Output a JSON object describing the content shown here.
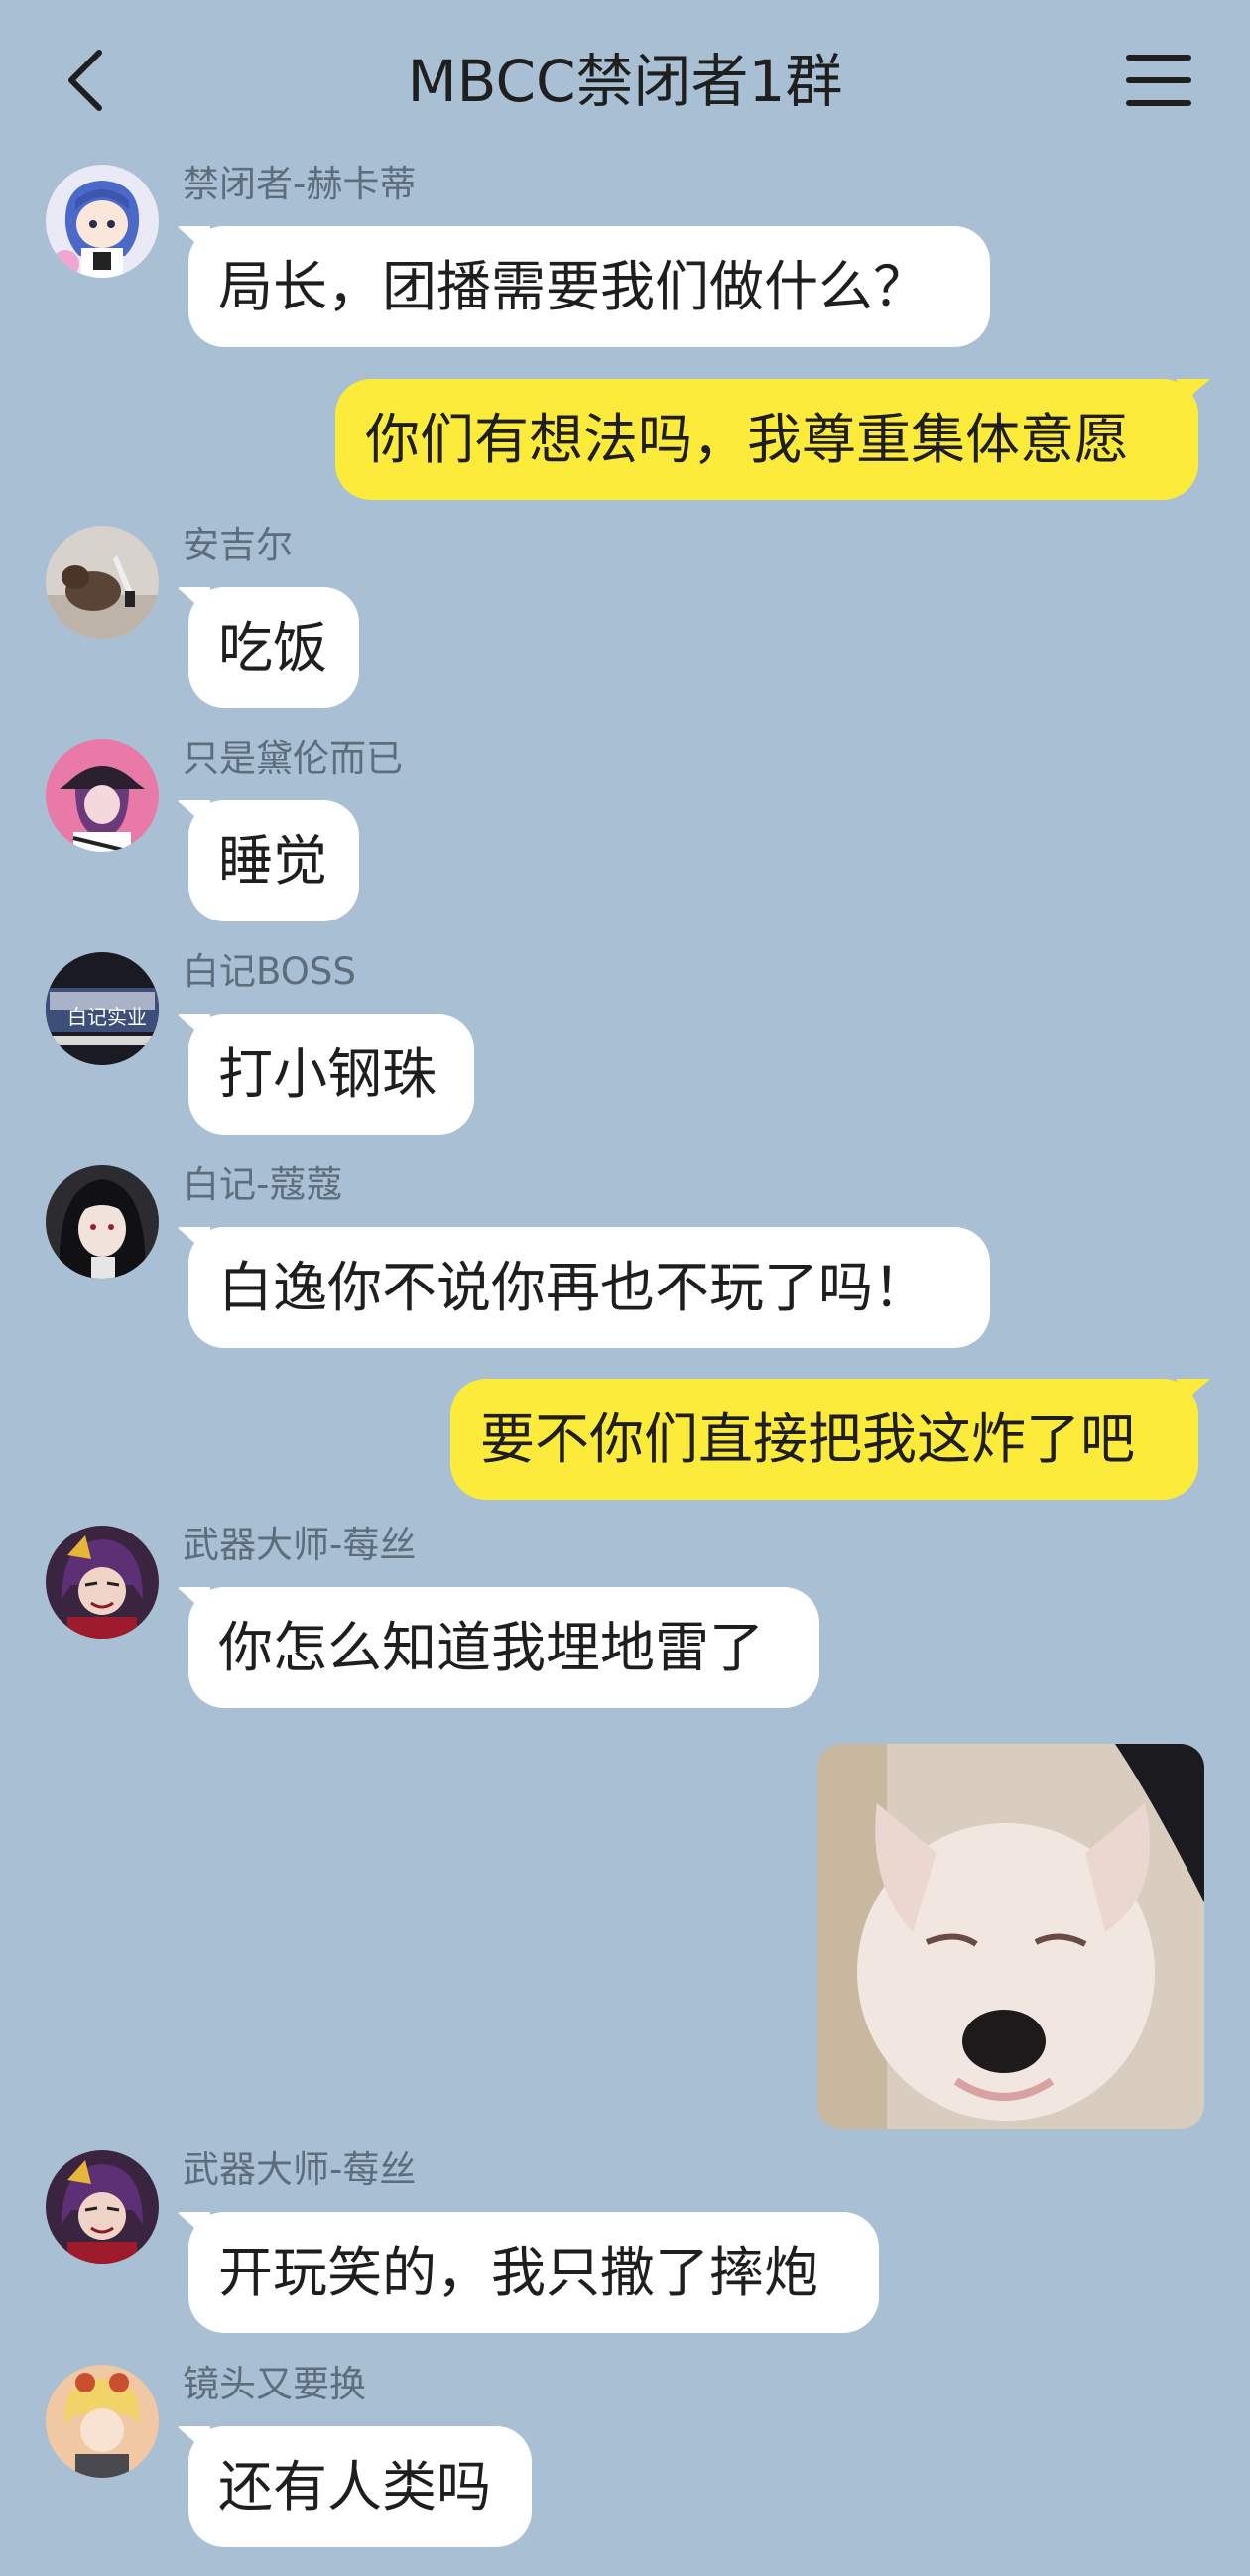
{
  "header": {
    "title": "MBCC禁闭者1群",
    "back_icon": "chevron-left-icon",
    "menu_icon": "hamburger-menu-icon"
  },
  "colors": {
    "background": "#a9bfd3",
    "incoming_bubble": "#ffffff",
    "outgoing_bubble": "#fceb3a",
    "sender_name": "#5d6d7c"
  },
  "messages": [
    {
      "type": "incoming",
      "sender": "禁闭者-赫卡蒂",
      "text": "局长，团播需要我们做什么？"
    },
    {
      "type": "outgoing",
      "text": "你们有想法吗，我尊重集体意愿"
    },
    {
      "type": "incoming",
      "sender": "安吉尔",
      "text": "吃饭"
    },
    {
      "type": "incoming",
      "sender": "只是黛伦而已",
      "text": "睡觉"
    },
    {
      "type": "incoming",
      "sender": "白记BOSS",
      "text": "打小钢珠"
    },
    {
      "type": "incoming",
      "sender": "白记-蔻蔻",
      "text": "白逸你不说你再也不玩了吗！"
    },
    {
      "type": "outgoing",
      "text": "要不你们直接把我这炸了吧"
    },
    {
      "type": "incoming",
      "sender": "武器大师-莓丝",
      "text": "你怎么知道我埋地雷了"
    },
    {
      "type": "outgoing-sticker",
      "sticker": "crying-puppy-sticker"
    },
    {
      "type": "incoming",
      "sender": "武器大师-莓丝",
      "text": "开玩笑的，我只撒了摔炮"
    },
    {
      "type": "incoming",
      "sender": "镜头又要换",
      "text": "还有人类吗"
    }
  ],
  "avatar_text": {
    "baiji_sign": "白记实业"
  }
}
